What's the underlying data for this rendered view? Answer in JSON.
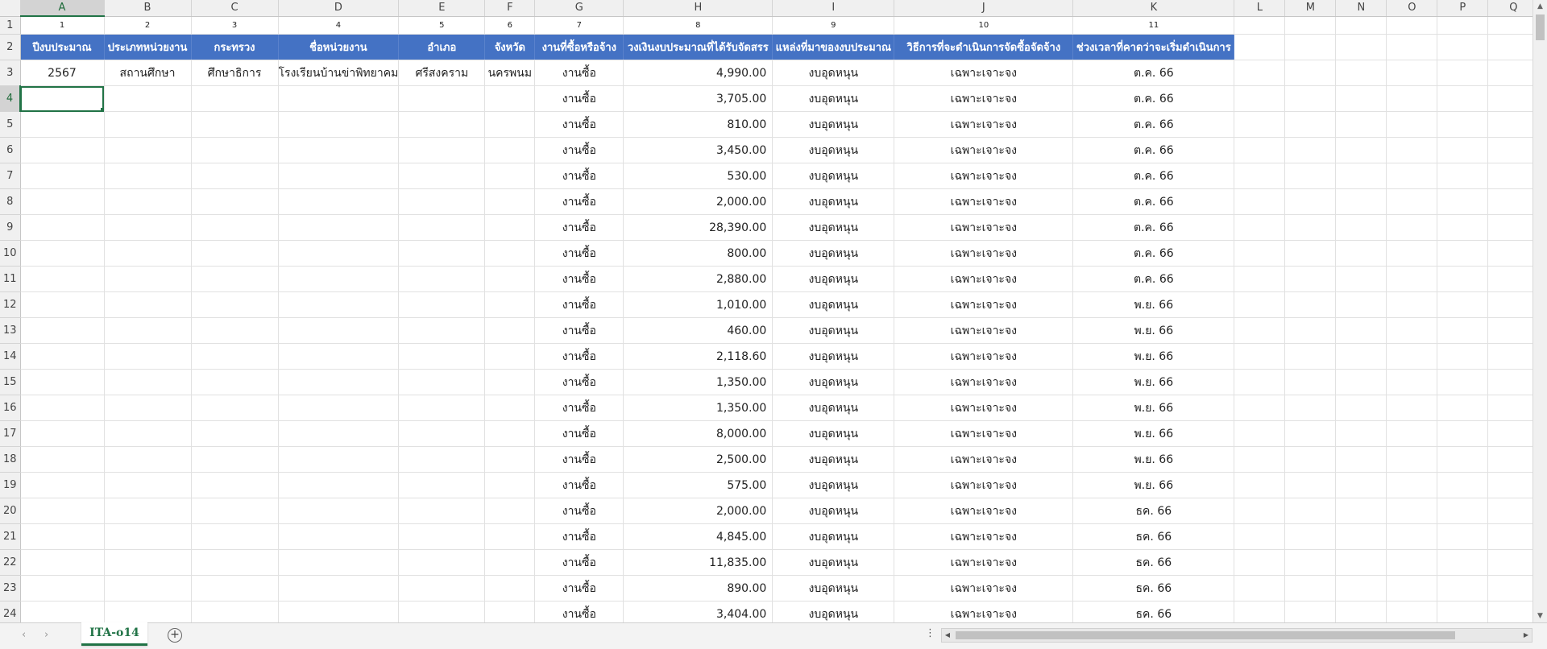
{
  "columns": [
    "A",
    "B",
    "C",
    "D",
    "E",
    "F",
    "G",
    "H",
    "I",
    "J",
    "K",
    "L",
    "M",
    "N",
    "O",
    "P",
    "Q"
  ],
  "selected_column": "A",
  "row_numbers": [
    "1",
    "2",
    "3",
    "4",
    "5",
    "6",
    "7",
    "8",
    "9",
    "10",
    "11",
    "12",
    "13",
    "14",
    "15",
    "16",
    "17",
    "18",
    "19",
    "20",
    "21",
    "22",
    "23",
    "24"
  ],
  "selected_row": "4",
  "index_row": [
    "1",
    "2",
    "3",
    "4",
    "5",
    "6",
    "7",
    "8",
    "9",
    "10",
    "11"
  ],
  "headers": [
    "ปีงบประมาณ",
    "ประเภทหน่วยงาน",
    "กระทรวง",
    "ชื่อหน่วยงาน",
    "อำเภอ",
    "จังหวัด",
    "งานที่ซื้อหรือจ้าง",
    "วงเงินงบประมาณที่ได้รับจัดสรร",
    "แหล่งที่มาของงบประมาณ",
    "วิธีการที่จะดำเนินการจัดซื้อจัดจ้าง",
    "ช่วงเวลาที่คาดว่าจะเริ่มดำเนินการ"
  ],
  "first_row": {
    "year": "2567",
    "unit_type": "สถานศึกษา",
    "ministry": "ศึกษาธิการ",
    "unit_name": "โรงเรียนบ้านข่าพิทยาคม",
    "district": "ศรีสงคราม",
    "province": "นครพนม"
  },
  "rows": [
    {
      "work": "งานซื้อ",
      "amount": "4,990.00",
      "source": "งบอุดหนุน",
      "method": "เฉพาะเจาะจง",
      "period": "ต.ค. 66"
    },
    {
      "work": "งานซื้อ",
      "amount": "3,705.00",
      "source": "งบอุดหนุน",
      "method": "เฉพาะเจาะจง",
      "period": "ต.ค. 66"
    },
    {
      "work": "งานซื้อ",
      "amount": "810.00",
      "source": "งบอุดหนุน",
      "method": "เฉพาะเจาะจง",
      "period": "ต.ค. 66"
    },
    {
      "work": "งานซื้อ",
      "amount": "3,450.00",
      "source": "งบอุดหนุน",
      "method": "เฉพาะเจาะจง",
      "period": "ต.ค. 66"
    },
    {
      "work": "งานซื้อ",
      "amount": "530.00",
      "source": "งบอุดหนุน",
      "method": "เฉพาะเจาะจง",
      "period": "ต.ค. 66"
    },
    {
      "work": "งานซื้อ",
      "amount": "2,000.00",
      "source": "งบอุดหนุน",
      "method": "เฉพาะเจาะจง",
      "period": "ต.ค. 66"
    },
    {
      "work": "งานซื้อ",
      "amount": "28,390.00",
      "source": "งบอุดหนุน",
      "method": "เฉพาะเจาะจง",
      "period": "ต.ค. 66"
    },
    {
      "work": "งานซื้อ",
      "amount": "800.00",
      "source": "งบอุดหนุน",
      "method": "เฉพาะเจาะจง",
      "period": "ต.ค. 66"
    },
    {
      "work": "งานซื้อ",
      "amount": "2,880.00",
      "source": "งบอุดหนุน",
      "method": "เฉพาะเจาะจง",
      "period": "ต.ค. 66"
    },
    {
      "work": "งานซื้อ",
      "amount": "1,010.00",
      "source": "งบอุดหนุน",
      "method": "เฉพาะเจาะจง",
      "period": "พ.ย. 66"
    },
    {
      "work": "งานซื้อ",
      "amount": "460.00",
      "source": "งบอุดหนุน",
      "method": "เฉพาะเจาะจง",
      "period": "พ.ย. 66"
    },
    {
      "work": "งานซื้อ",
      "amount": "2,118.60",
      "source": "งบอุดหนุน",
      "method": "เฉพาะเจาะจง",
      "period": "พ.ย. 66"
    },
    {
      "work": "งานซื้อ",
      "amount": "1,350.00",
      "source": "งบอุดหนุน",
      "method": "เฉพาะเจาะจง",
      "period": "พ.ย. 66"
    },
    {
      "work": "งานซื้อ",
      "amount": "1,350.00",
      "source": "งบอุดหนุน",
      "method": "เฉพาะเจาะจง",
      "period": "พ.ย. 66"
    },
    {
      "work": "งานซื้อ",
      "amount": "8,000.00",
      "source": "งบอุดหนุน",
      "method": "เฉพาะเจาะจง",
      "period": "พ.ย. 66"
    },
    {
      "work": "งานซื้อ",
      "amount": "2,500.00",
      "source": "งบอุดหนุน",
      "method": "เฉพาะเจาะจง",
      "period": "พ.ย. 66"
    },
    {
      "work": "งานซื้อ",
      "amount": "575.00",
      "source": "งบอุดหนุน",
      "method": "เฉพาะเจาะจง",
      "period": "พ.ย. 66"
    },
    {
      "work": "งานซื้อ",
      "amount": "2,000.00",
      "source": "งบอุดหนุน",
      "method": "เฉพาะเจาะจง",
      "period": "ธค. 66"
    },
    {
      "work": "งานซื้อ",
      "amount": "4,845.00",
      "source": "งบอุดหนุน",
      "method": "เฉพาะเจาะจง",
      "period": "ธค. 66"
    },
    {
      "work": "งานซื้อ",
      "amount": "11,835.00",
      "source": "งบอุดหนุน",
      "method": "เฉพาะเจาะจง",
      "period": "ธค. 66"
    },
    {
      "work": "งานซื้อ",
      "amount": "890.00",
      "source": "งบอุดหนุน",
      "method": "เฉพาะเจาะจง",
      "period": "ธค. 66"
    },
    {
      "work": "งานซื้อ",
      "amount": "3,404.00",
      "source": "งบอุดหนุน",
      "method": "เฉพาะเจาะจง",
      "period": "ธค. 66"
    }
  ],
  "sheet_tab": "ITA-o14",
  "header_color": "#4472c4",
  "accent_color": "#217346",
  "icons": {
    "prev_sheet": "chevron-left-icon",
    "next_sheet": "chevron-right-icon",
    "add_sheet": "plus-circle-icon",
    "options": "more-vertical-icon"
  }
}
